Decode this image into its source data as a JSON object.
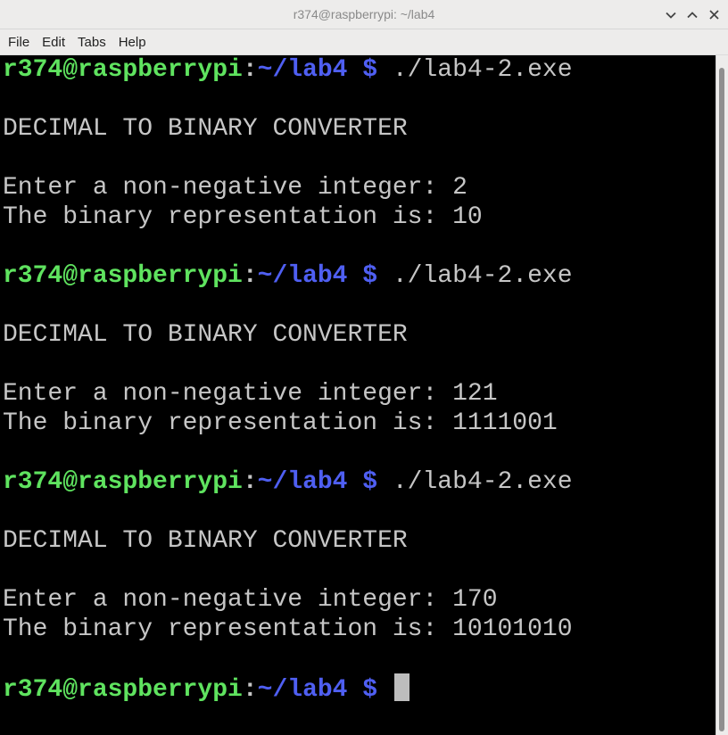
{
  "window": {
    "title": "r374@raspberrypi: ~/lab4"
  },
  "menu": {
    "items": [
      "File",
      "Edit",
      "Tabs",
      "Help"
    ]
  },
  "terminal": {
    "prompt_user": "r374@raspberrypi",
    "prompt_colon": ":",
    "prompt_path": "~/lab4 $",
    "command": " ./lab4-2.exe",
    "runs": [
      {
        "header": "DECIMAL TO BINARY CONVERTER",
        "input_line": "Enter a non-negative integer: 2",
        "output_line": "The binary representation is: 10"
      },
      {
        "header": "DECIMAL TO BINARY CONVERTER",
        "input_line": "Enter a non-negative integer: 121",
        "output_line": "The binary representation is: 1111001"
      },
      {
        "header": "DECIMAL TO BINARY CONVERTER",
        "input_line": "Enter a non-negative integer: 170",
        "output_line": "The binary representation is: 10101010"
      }
    ]
  },
  "colors": {
    "prompt_user": "#5fe35f",
    "prompt_path": "#4f5ff2",
    "text": "#c6c6c6",
    "background": "#000000",
    "chrome": "#edeceb"
  },
  "icons": {
    "minimize": "chevron-down-icon",
    "maximize": "chevron-up-icon",
    "close": "close-icon"
  }
}
